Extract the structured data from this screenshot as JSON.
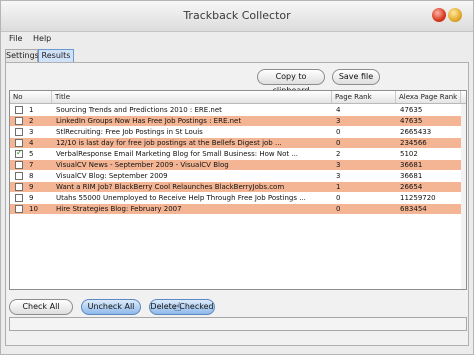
{
  "window": {
    "title": "Trackback Collector"
  },
  "menu": {
    "file": "File",
    "help": "Help"
  },
  "tabs": [
    {
      "label": "Settings"
    },
    {
      "label": "Results"
    }
  ],
  "toolbar": {
    "copy": "Copy to clipboard",
    "save": "Save file"
  },
  "grid": {
    "columns": [
      "No",
      "Title",
      "Page Rank",
      "Alexa Page Rank"
    ],
    "rows": [
      {
        "checked": false,
        "no": "1",
        "title": "Sourcing Trends and Predictions 2010 : ERE.net",
        "pr": "4",
        "alexa": "47635",
        "highlight": false
      },
      {
        "checked": false,
        "no": "2",
        "title": "LinkedIn Groups Now Has Free Job Postings : ERE.net",
        "pr": "3",
        "alexa": "47635",
        "highlight": true
      },
      {
        "checked": false,
        "no": "3",
        "title": "StlRecruiting: Free Job Postings in St Louis",
        "pr": "0",
        "alexa": "2665433",
        "highlight": false
      },
      {
        "checked": false,
        "no": "4",
        "title": "12/10 is last day for free job postings at the Bellefs Digest job ...",
        "pr": "0",
        "alexa": "234566",
        "highlight": true
      },
      {
        "checked": true,
        "no": "5",
        "title": "VerbalResponse Email Marketing Blog for Small Business: How Not ...",
        "pr": "2",
        "alexa": "5102",
        "highlight": false
      },
      {
        "checked": false,
        "no": "7",
        "title": "VisualCV News - September 2009 - VisualCV Blog",
        "pr": "3",
        "alexa": "36681",
        "highlight": true
      },
      {
        "checked": false,
        "no": "8",
        "title": "VisualCV Blog: September 2009",
        "pr": "3",
        "alexa": "36681",
        "highlight": false
      },
      {
        "checked": false,
        "no": "9",
        "title": "Want a RIM Job? BlackBerry Cool Relaunches BlackBerryJobs.com",
        "pr": "1",
        "alexa": "26654",
        "highlight": true
      },
      {
        "checked": false,
        "no": "9",
        "title": "Utahs 55000 Unemployed to Receive Help Through Free Job Postings ...",
        "pr": "0",
        "alexa": "11259720",
        "highlight": false
      },
      {
        "checked": false,
        "no": "10",
        "title": "Hire Strategies Blog: February 2007",
        "pr": "0",
        "alexa": "683454",
        "highlight": true
      }
    ]
  },
  "actions": {
    "check_all": "Check All",
    "uncheck_all": "Uncheck All",
    "delete_checked": "Delete Checked"
  },
  "colors": {
    "highlight": "#f4b594",
    "selected_tab": "#cfe2f8",
    "accent": "#5a88c2"
  },
  "icons": {
    "close": "close-icon",
    "minimize": "minimize-icon",
    "mouse_pointer": "mouse-pointer-icon",
    "row_marker": "row-arrow-icon"
  }
}
